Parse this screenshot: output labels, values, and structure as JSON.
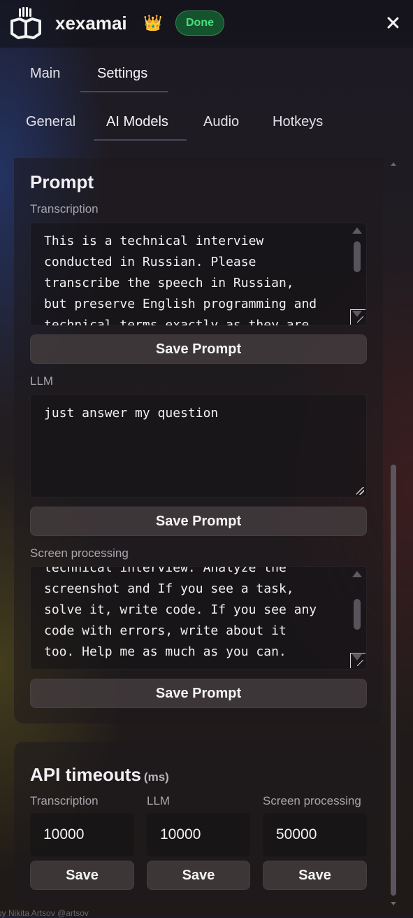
{
  "header": {
    "app_name": "xexamai",
    "crown_icon": "👑",
    "status_badge": "Done",
    "badge_color": "#4ade80"
  },
  "main_tabs": [
    {
      "label": "Main"
    },
    {
      "label": "Settings"
    }
  ],
  "sub_tabs": [
    {
      "label": "General"
    },
    {
      "label": "AI Models"
    },
    {
      "label": "Audio"
    },
    {
      "label": "Hotkeys"
    }
  ],
  "prompt": {
    "title": "Prompt",
    "transcription": {
      "label": "Transcription",
      "value": "This is a technical interview\nconducted in Russian. Please\ntranscribe the speech in Russian,\nbut preserve English programming and\ntechnical terms exactly as they are",
      "save_label": "Save Prompt"
    },
    "llm": {
      "label": "LLM",
      "value": "just answer my question",
      "save_label": "Save Prompt"
    },
    "screen": {
      "label": "Screen processing",
      "value": "technical interview. Analyze the\nscreenshot and If you see a task,\nsolve it, write code. If you see any\ncode with errors, write about it\ntoo. Help me as much as you can.",
      "save_label": "Save Prompt"
    }
  },
  "timeouts": {
    "title": "API timeouts",
    "unit": "(ms)",
    "fields": [
      {
        "label": "Transcription",
        "value": "10000",
        "save_label": "Save"
      },
      {
        "label": "LLM",
        "value": "10000",
        "save_label": "Save"
      },
      {
        "label": "Screen processing",
        "value": "50000",
        "save_label": "Save"
      }
    ]
  },
  "footer": "by Nikita Artsov @artsov"
}
